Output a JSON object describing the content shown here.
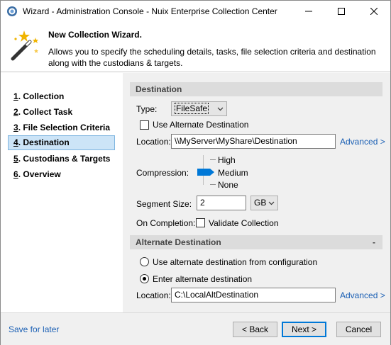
{
  "window": {
    "title": "Wizard - Administration Console - Nuix Enterprise Collection Center"
  },
  "header": {
    "title": "New Collection Wizard.",
    "description": "Allows you to specify the scheduling details, tasks, file selection criteria and destination along with the custodians & targets."
  },
  "nav": {
    "items": [
      {
        "num": "1",
        "label": ". Collection"
      },
      {
        "num": "2",
        "label": ". Collect Task"
      },
      {
        "num": "3",
        "label": ". File Selection Criteria"
      },
      {
        "num": "4",
        "label": ". Destination"
      },
      {
        "num": "5",
        "label": ". Custodians & Targets"
      },
      {
        "num": "6",
        "label": ". Overview"
      }
    ],
    "active_index": 3
  },
  "destination": {
    "section_title": "Destination",
    "type_label": "Type:",
    "type_value": "FileSafe",
    "use_alternate_label": "Use Alternate Destination",
    "use_alternate_checked": false,
    "location_label": "Location:",
    "location_value": "\\\\MyServer\\MyShare\\Destination",
    "advanced_link": "Advanced >",
    "compression_label": "Compression:",
    "compression_levels": [
      "High",
      "Medium",
      "None"
    ],
    "compression_selected": "Medium",
    "segment_size_label": "Segment Size:",
    "segment_size_value": "2",
    "segment_unit": "GB",
    "on_completion_label": "On Completion:",
    "validate_label": "Validate Collection",
    "validate_checked": false
  },
  "alternate": {
    "section_title": "Alternate Destination",
    "collapse_symbol": "-",
    "option_config_label": "Use alternate destination from configuration",
    "option_enter_label": "Enter alternate destination",
    "selected_option": "enter",
    "location_label": "Location:",
    "location_value": "C:\\LocalAltDestination",
    "advanced_link": "Advanced >"
  },
  "footer": {
    "save_link": "Save for later",
    "back_label": "< Back",
    "next_label": "Next >",
    "cancel_label": "Cancel"
  },
  "colors": {
    "accent": "#0078d7",
    "link": "#1a5fb4",
    "nav_active_bg": "#cce4f7"
  }
}
